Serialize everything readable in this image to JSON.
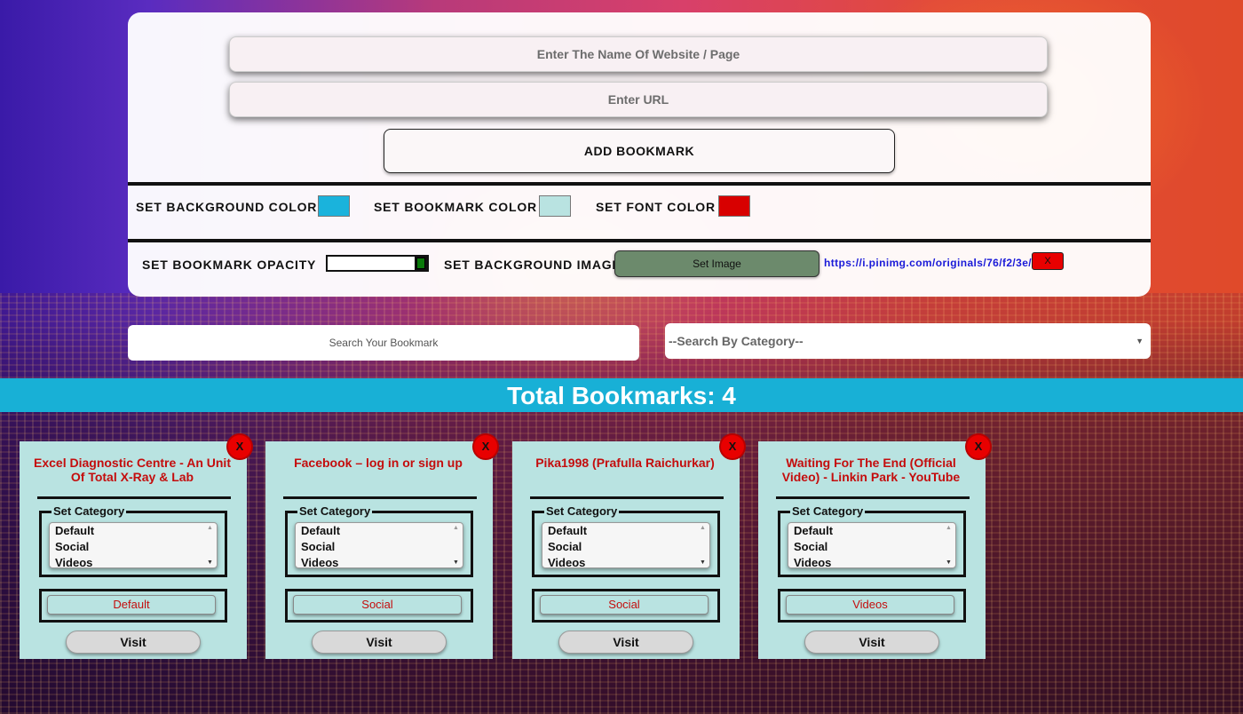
{
  "form": {
    "name_placeholder": "Enter The Name Of Website / Page",
    "url_placeholder": "Enter URL",
    "add_label": "ADD BOOKMARK"
  },
  "settings": {
    "bg_color_label": "SET BACKGROUND COLOR",
    "bg_color_value": "#1ab3dc",
    "bookmark_color_label": "SET BOOKMARK COLOR",
    "bookmark_color_value": "#b9e3e1",
    "font_color_label": "SET FONT COLOR",
    "font_color_value": "#d80000",
    "opacity_label": "SET BOOKMARK OPACITY",
    "opacity_value": 1.0,
    "bg_image_label": "SET BACKGROUND IMAGE",
    "set_image_label": "Set Image",
    "image_url": "https://i.pinimg.com/originals/76/f2/3e/",
    "clear_image_label": "X"
  },
  "search": {
    "placeholder": "Search Your Bookmark",
    "category_selected": "--Search By Category--"
  },
  "total": {
    "label": "Total Bookmarks: 4"
  },
  "category_options": [
    "Default",
    "Social",
    "Videos"
  ],
  "bookmarks": [
    {
      "title": "Excel Diagnostic Centre - An Unit Of Total X-Ray & Lab",
      "category": "Default",
      "set_category_label": "Set Category",
      "visit_label": "Visit",
      "close_label": "X"
    },
    {
      "title": "Facebook – log in or sign up",
      "category": "Social",
      "set_category_label": "Set Category",
      "visit_label": "Visit",
      "close_label": "X"
    },
    {
      "title": "Pika1998 (Prafulla Raichurkar)",
      "category": "Social",
      "set_category_label": "Set Category",
      "visit_label": "Visit",
      "close_label": "X"
    },
    {
      "title": "Waiting For The End (Official Video) - Linkin Park - YouTube",
      "category": "Videos",
      "set_category_label": "Set Category",
      "visit_label": "Visit",
      "close_label": "X"
    }
  ]
}
